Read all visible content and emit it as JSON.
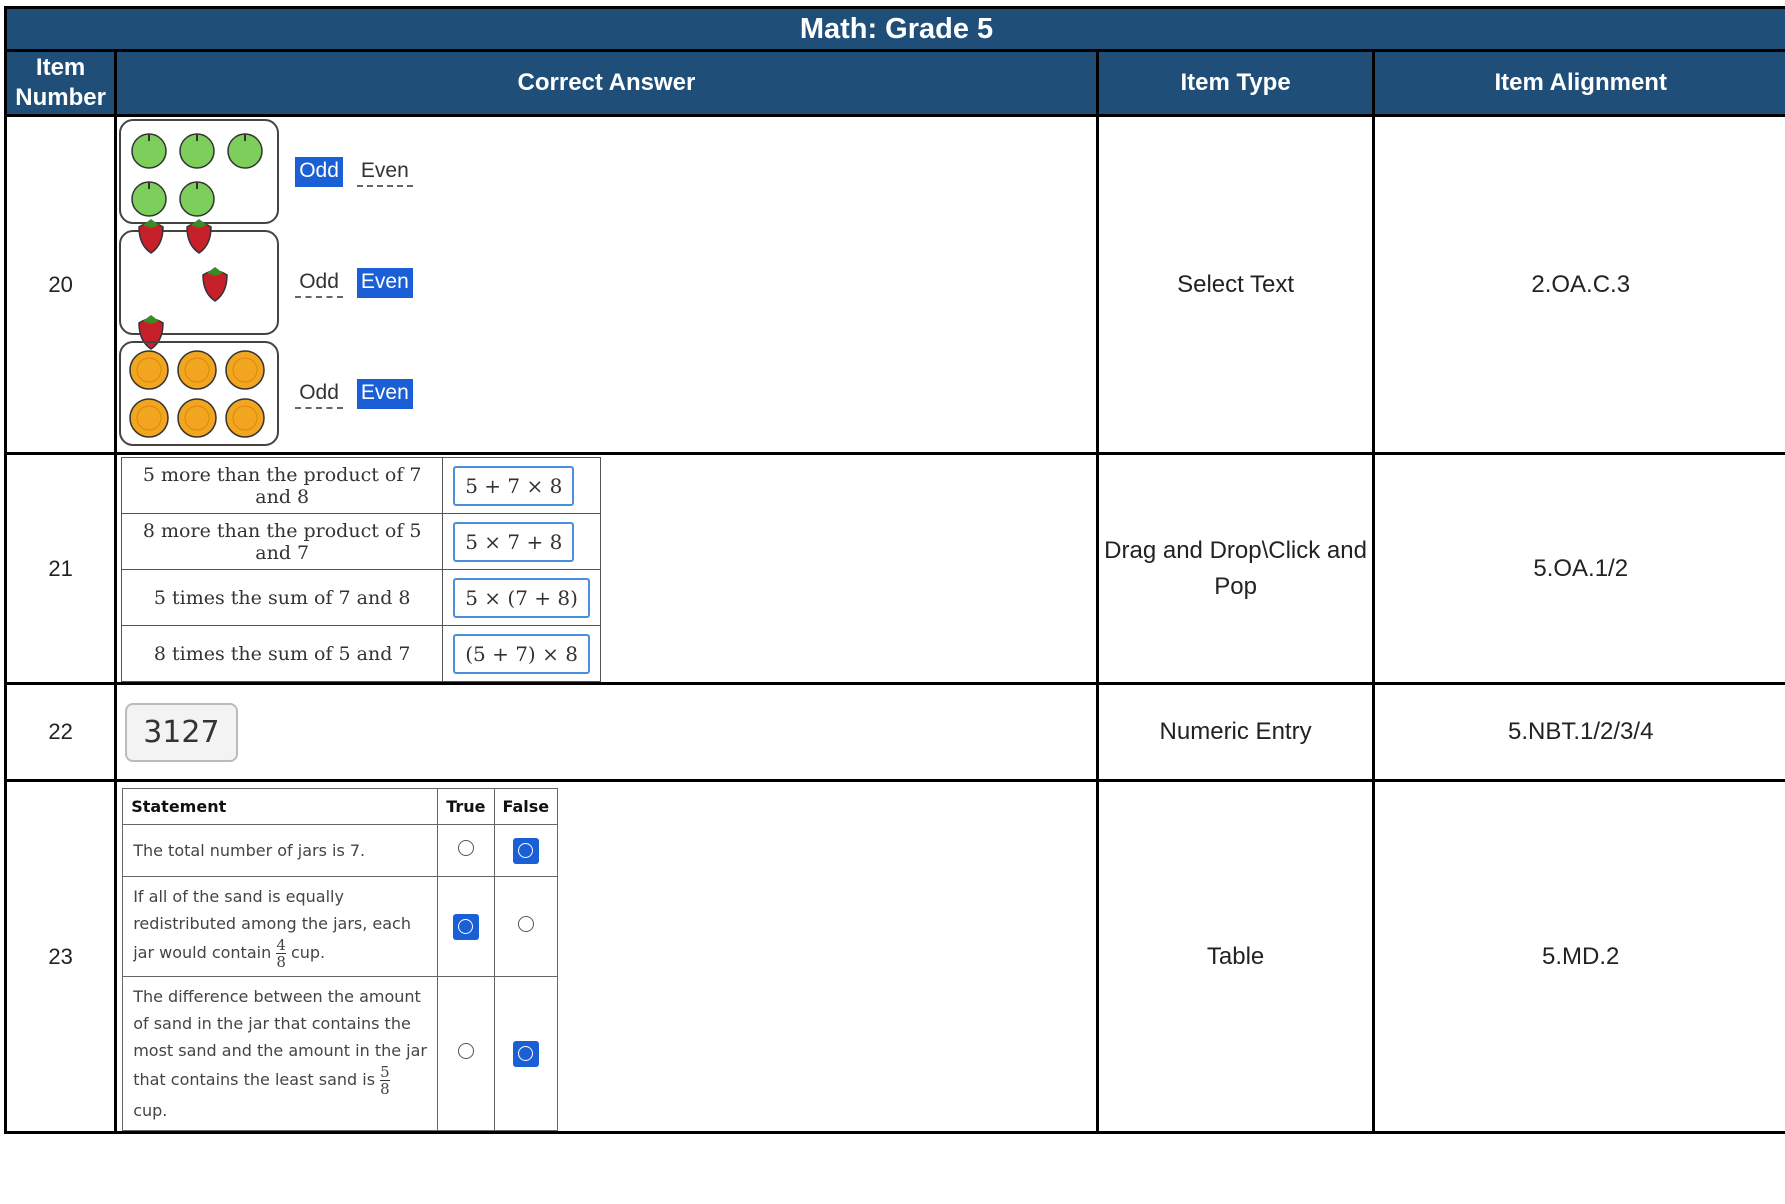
{
  "title": "Math: Grade 5",
  "headers": {
    "item_number": "Item Number",
    "correct_answer": "Correct Answer",
    "item_type": "Item Type",
    "item_alignment": "Item Alignment"
  },
  "items": [
    {
      "number": "20",
      "type": "Select Text",
      "alignment": "2.OA.C.3",
      "groups": [
        {
          "fruit": "apple-icon",
          "count": 5,
          "odd": "Odd",
          "even": "Even",
          "selected": "odd"
        },
        {
          "fruit": "strawberry-icon",
          "count": 4,
          "odd": "Odd",
          "even": "Even",
          "selected": "even"
        },
        {
          "fruit": "orange-icon",
          "count": 6,
          "odd": "Odd",
          "even": "Even",
          "selected": "even"
        }
      ]
    },
    {
      "number": "21",
      "type": "Drag and Drop\\Click and Pop",
      "alignment": "5.OA.1/2",
      "rows": [
        {
          "label": "5 more than the product of 7 and 8",
          "answer": "5 + 7 × 8"
        },
        {
          "label": "8 more than the product of 5 and 7",
          "answer": "5 × 7 + 8"
        },
        {
          "label": "5 times the sum of 7 and 8",
          "answer": "5 × (7 + 8)"
        },
        {
          "label": "8 times the sum of 5 and 7",
          "answer": "(5 + 7) × 8"
        }
      ]
    },
    {
      "number": "22",
      "type": "Numeric Entry",
      "alignment": "5.NBT.1/2/3/4",
      "value": "3127"
    },
    {
      "number": "23",
      "type": "Table",
      "alignment": "5.MD.2",
      "table_headers": {
        "statement": "Statement",
        "true": "True",
        "false": "False"
      },
      "rows": [
        {
          "text": "The total number of jars is 7.",
          "selected": "false"
        },
        {
          "text_a": "If all of the sand is equally redistributed among the jars, each jar would contain",
          "frac_num": "4",
          "frac_den": "8",
          "text_b": "cup.",
          "selected": "true"
        },
        {
          "text_a": "The difference between the amount of sand in the jar that contains the most sand and the amount in the jar that contains the least sand is",
          "frac_num": "5",
          "frac_den": "8",
          "text_b": "cup.",
          "selected": "false"
        }
      ]
    }
  ],
  "colors": {
    "header_bg": "#1f4e79",
    "selected_blue": "#1a5fd6",
    "apple": "#7ccf5a",
    "strawberry": "#c8202a",
    "orange": "#f2a51e"
  }
}
